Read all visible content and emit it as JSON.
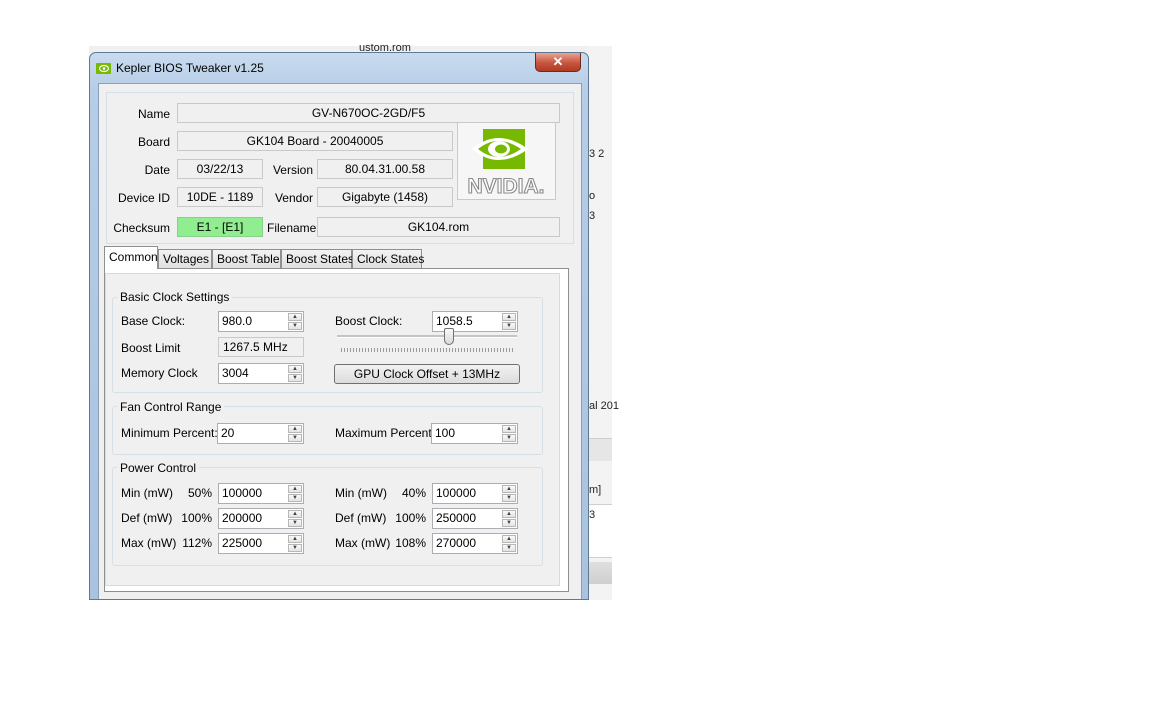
{
  "background_window": {
    "fragments": [
      "ustom.rom",
      "3 2",
      "o",
      "3",
      "al 201",
      "m]",
      "3"
    ]
  },
  "window": {
    "title": "Kepler BIOS Tweaker v1.25",
    "close_glyph": "✕"
  },
  "header": {
    "name_label": "Name",
    "name_value": "GV-N670OC-2GD/F5",
    "board_label": "Board",
    "board_value": "GK104 Board - 20040005",
    "date_label": "Date",
    "date_value": "03/22/13",
    "version_label": "Version",
    "version_value": "80.04.31.00.58",
    "device_id_label": "Device ID",
    "device_id_value": "10DE - 1189",
    "vendor_label": "Vendor",
    "vendor_value": "Gigabyte (1458)",
    "checksum_label": "Checksum",
    "checksum_value": "E1 - [E1]",
    "filename_label": "Filename",
    "filename_value": "GK104.rom",
    "logo_text": "NVIDIA."
  },
  "tabs": [
    {
      "label": "Common",
      "active": true
    },
    {
      "label": "Voltages"
    },
    {
      "label": "Boost Table"
    },
    {
      "label": "Boost States"
    },
    {
      "label": "Clock States"
    }
  ],
  "basic_clock": {
    "title": "Basic Clock Settings",
    "base_clock_label": "Base Clock:",
    "base_clock_value": "980.0",
    "boost_clock_label": "Boost Clock:",
    "boost_clock_value": "1058.5",
    "boost_limit_label": "Boost Limit",
    "boost_limit_value": "1267.5 MHz",
    "memory_clock_label": "Memory Clock",
    "memory_clock_value": "3004",
    "offset_button": "GPU Clock Offset + 13MHz",
    "slider_fraction": 0.63
  },
  "fan_control": {
    "title": "Fan Control Range",
    "min_label": "Minimum Percent:",
    "min_value": "20",
    "max_label": "Maximum Percent:",
    "max_value": "100"
  },
  "power_control": {
    "title": "Power Control",
    "left": [
      {
        "label": "Min (mW)",
        "pct": "50%",
        "value": "100000"
      },
      {
        "label": "Def (mW)",
        "pct": "100%",
        "value": "200000"
      },
      {
        "label": "Max (mW)",
        "pct": "112%",
        "value": "225000"
      }
    ],
    "right": [
      {
        "label": "Min (mW)",
        "pct": "40%",
        "value": "100000"
      },
      {
        "label": "Def (mW)",
        "pct": "100%",
        "value": "250000"
      },
      {
        "label": "Max (mW)",
        "pct": "108%",
        "value": "270000"
      }
    ]
  },
  "spin_glyphs": {
    "up": "▲",
    "down": "▼"
  },
  "colors": {
    "checksum_ok": "#90ee90",
    "nvidia_green": "#76b900"
  }
}
